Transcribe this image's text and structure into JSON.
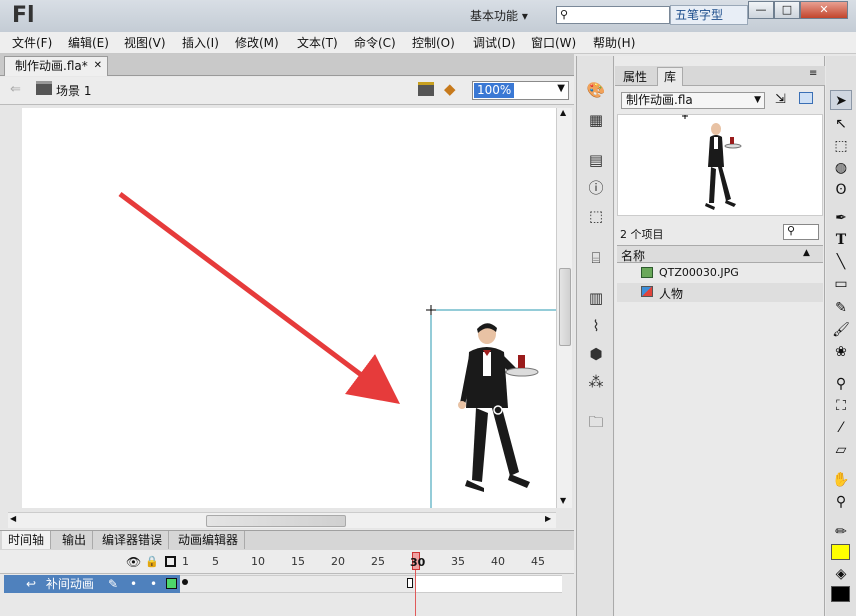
{
  "app": {
    "logo": "Fl",
    "workspace_label": "基本功能",
    "ime_label": "五笔字型"
  },
  "window": {
    "minimize": "—",
    "maximize": "□",
    "close": "✕"
  },
  "menu": [
    "文件(F)",
    "编辑(E)",
    "视图(V)",
    "插入(I)",
    "修改(M)",
    "文本(T)",
    "命令(C)",
    "控制(O)",
    "调试(D)",
    "窗口(W)",
    "帮助(H)"
  ],
  "document": {
    "tab_title": "制作动画.fla*",
    "scene_label": "场景 1",
    "zoom": "100%"
  },
  "timeline": {
    "tabs": [
      "时间轴",
      "输出",
      "编译器错误",
      "动画编辑器"
    ],
    "ticks": [
      "1",
      "5",
      "10",
      "15",
      "20",
      "25",
      "30",
      "35",
      "40",
      "45"
    ],
    "current_frame": "30",
    "layer_name": "补间动画"
  },
  "library": {
    "tabs": [
      "属性",
      "库"
    ],
    "file_select": "制作动画.fla",
    "item_count": "2 个项目",
    "column_name": "名称",
    "items": [
      {
        "name": "QTZ00030.JPG",
        "icon": "bitmap-icon"
      },
      {
        "name": "人物",
        "icon": "graphic-symbol-icon"
      }
    ]
  },
  "colors": {
    "arrow": "#e63b3b",
    "layer_highlight": "#4f81bd",
    "playhead": "#e05a5a",
    "fill_color": "#ffff00",
    "stroke_color": "#000000"
  }
}
